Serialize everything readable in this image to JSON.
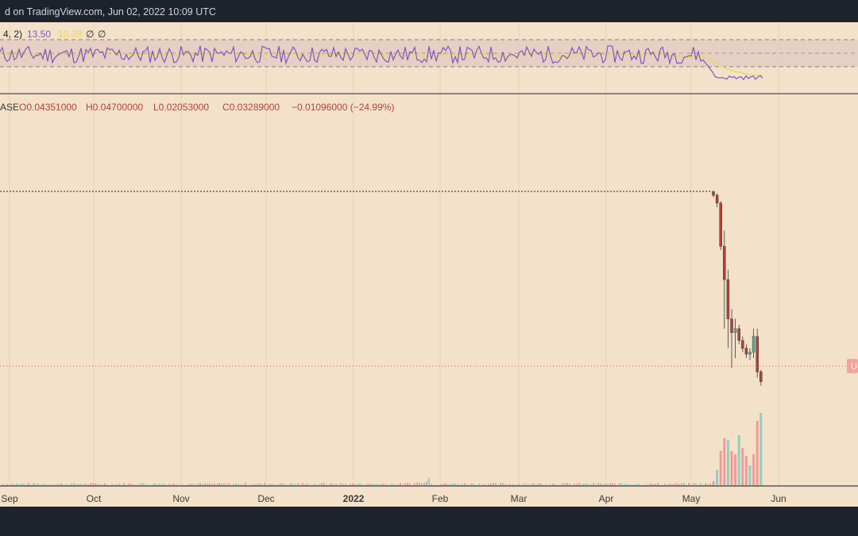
{
  "header": {
    "caption": "d on TradingView.com, Jun 02, 2022 10:09 UTC"
  },
  "rsi_legend": {
    "params": "4, 2)",
    "rsi_value": "13.50",
    "ma_value": "10.39",
    "extra_1": "∅",
    "extra_2": "∅"
  },
  "ohlc_legend": {
    "symbol_fragment": "ASE",
    "open": "O0.04351000",
    "high": "H0.04700000",
    "low": "L0.02053000",
    "close": "C0.03289000",
    "change": "−0.01096000 (−24.99%)"
  },
  "price_tag": {
    "label": "U"
  },
  "colors": {
    "background": "#f3e1c9",
    "chrome": "#1e222d",
    "up": "#4fb5a4",
    "down": "#b5413b",
    "down_volume": "#f29b98",
    "up_volume": "#8fcfc2",
    "rsi_line": "#7e57c2",
    "rsi_ma": "#f2d54a",
    "rsi_band": "#e2c9c0",
    "last_price": "#e0534d",
    "tag": "#f6a29e"
  },
  "chart_data": {
    "type": "candlestick",
    "x_labels": [
      "Sep",
      "Oct",
      "Nov",
      "Dec",
      "2022",
      "Feb",
      "Mar",
      "Apr",
      "May",
      "Jun"
    ],
    "price_series": {
      "note_units": "USD",
      "flat_level": 1.0,
      "candles_may": [
        {
          "o": 1.0,
          "h": 1.0,
          "l": 0.97,
          "c": 0.98
        },
        {
          "o": 0.98,
          "h": 0.99,
          "l": 0.92,
          "c": 0.94
        },
        {
          "o": 0.94,
          "h": 0.95,
          "l": 0.7,
          "c": 0.72
        },
        {
          "o": 0.72,
          "h": 0.8,
          "l": 0.3,
          "c": 0.55
        },
        {
          "o": 0.55,
          "h": 0.6,
          "l": 0.2,
          "c": 0.35
        },
        {
          "o": 0.35,
          "h": 0.4,
          "l": 0.1,
          "c": 0.28
        },
        {
          "o": 0.28,
          "h": 0.35,
          "l": 0.15,
          "c": 0.3
        },
        {
          "o": 0.3,
          "h": 0.32,
          "l": 0.22,
          "c": 0.24
        },
        {
          "o": 0.24,
          "h": 0.26,
          "l": 0.18,
          "c": 0.2
        },
        {
          "o": 0.2,
          "h": 0.22,
          "l": 0.15,
          "c": 0.17
        },
        {
          "o": 0.17,
          "h": 0.2,
          "l": 0.14,
          "c": 0.18
        },
        {
          "o": 0.18,
          "h": 0.3,
          "l": 0.15,
          "c": 0.26
        },
        {
          "o": 0.26,
          "h": 0.3,
          "l": 0.05,
          "c": 0.08
        },
        {
          "o": 0.08,
          "h": 0.09,
          "l": 0.01,
          "c": 0.03
        }
      ]
    },
    "rsi": {
      "upper_band": 70,
      "lower_band": 30,
      "last_rsi": 13.5,
      "last_ma": 10.39
    }
  }
}
